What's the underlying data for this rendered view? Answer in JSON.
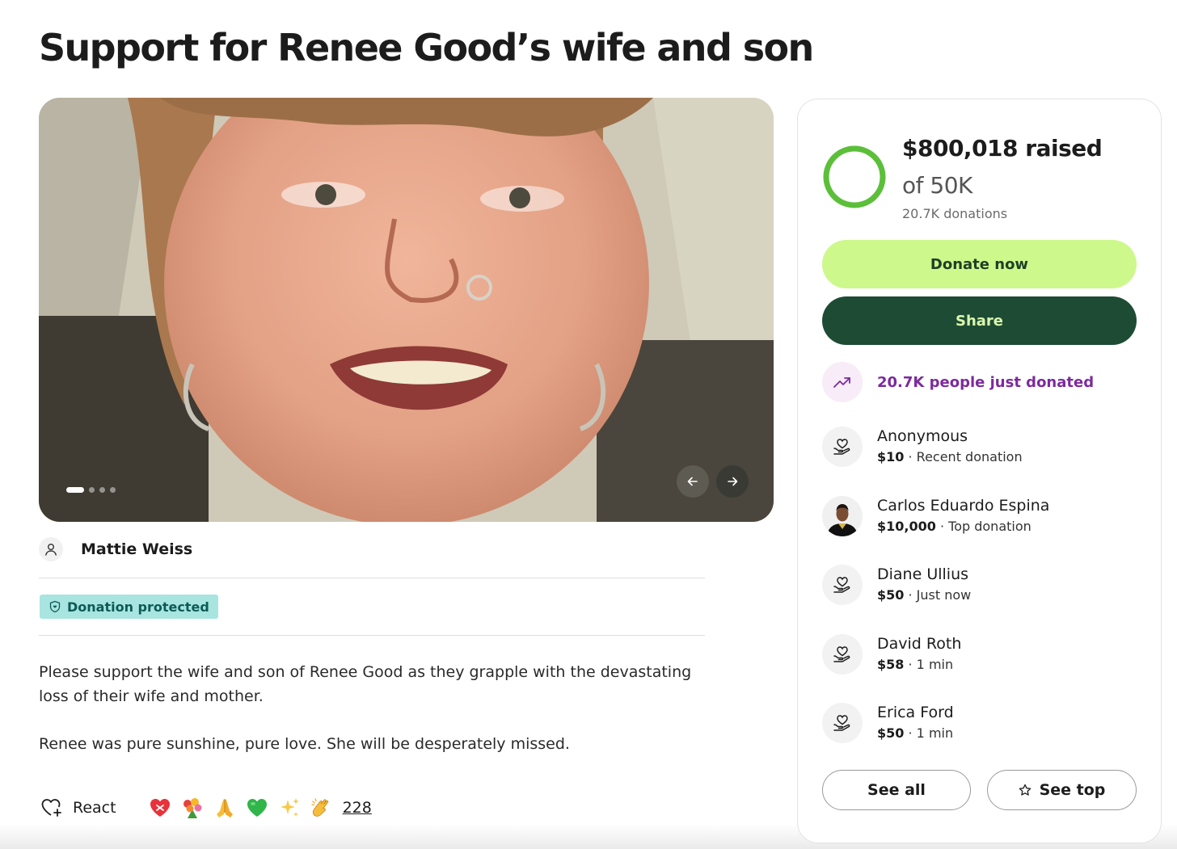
{
  "campaign": {
    "title": "Support for Renee Good’s wife and son",
    "organizer_name": "Mattie Weiss",
    "badge_label": "Donation protected",
    "story": [
      "Please support the wife and son of Renee Good as they grapple with the devastating loss of their wife and mother.",
      "Renee was pure sunshine, pure love. She will be desperately missed."
    ]
  },
  "photo": {
    "carousel_slides": 4,
    "active_slide": 1
  },
  "reactions": {
    "label": "React",
    "emojis": [
      "heart-mend-emoji",
      "bouquet-emoji",
      "praying-hands-emoji",
      "green-heart-emoji",
      "sparkles-emoji",
      "clapping-hands-emoji"
    ],
    "count": "228"
  },
  "fundraiser": {
    "raised": "$800,018 raised",
    "goal": "of 50K",
    "donations": "20.7K donations",
    "progress_fraction": 1.0,
    "donate_label": "Donate now",
    "share_label": "Share",
    "trend_text": "20.7K people just donated",
    "see_all_label": "See all",
    "see_top_label": "See top"
  },
  "donors": [
    {
      "name": "Anonymous",
      "amount": "$10",
      "note": "· Recent donation",
      "icon": "donation-heart-icon"
    },
    {
      "name": "Carlos Eduardo Espina",
      "amount": "$10,000",
      "note": "· Top donation",
      "icon": "avatar-photo"
    },
    {
      "name": "Diane Ullius",
      "amount": "$50",
      "note": "· Just now",
      "icon": "donation-heart-icon"
    },
    {
      "name": "David Roth",
      "amount": "$58",
      "note": "· 1 min",
      "icon": "donation-heart-icon"
    },
    {
      "name": "Erica Ford",
      "amount": "$50",
      "note": "· 1 min",
      "icon": "donation-heart-icon"
    }
  ],
  "colors": {
    "donate_button": "#cdf88c",
    "share_button": "#1e4b34",
    "progress_ring": "#5cbf3a",
    "trend_purple": "#7d2a9d",
    "badge_bg": "#a8e5e0"
  }
}
